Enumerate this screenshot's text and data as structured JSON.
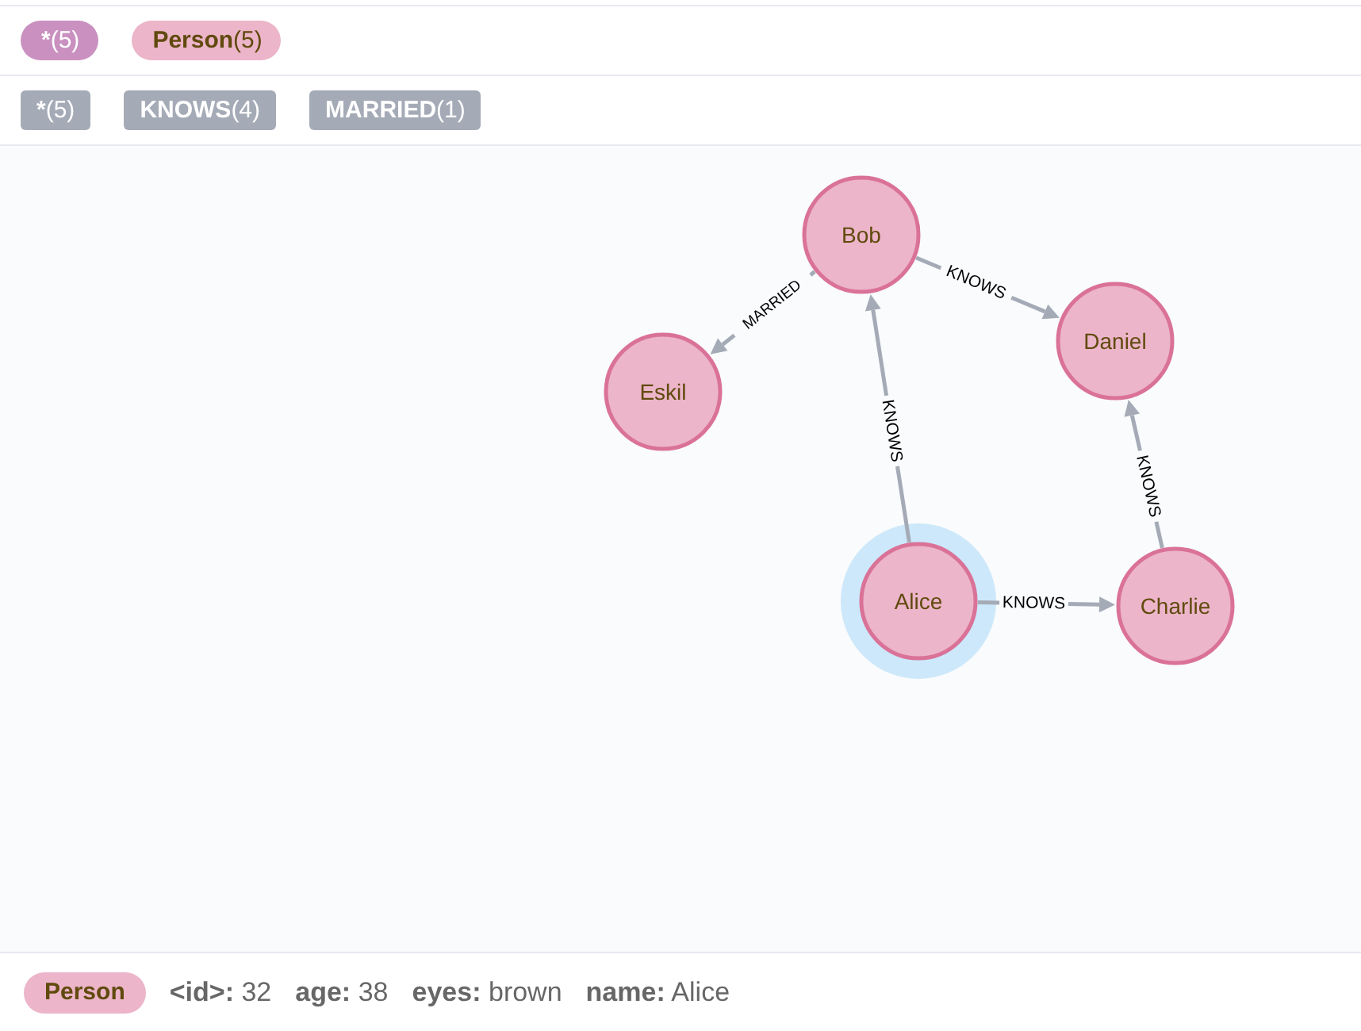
{
  "node_labels": [
    {
      "name": "*",
      "count": "(5)",
      "kind": "all",
      "color": "#c990c0"
    },
    {
      "name": "Person",
      "count": "(5)",
      "kind": "label",
      "color": "#ecb5c9"
    }
  ],
  "relationship_types": [
    {
      "name": "*",
      "count": "(5)"
    },
    {
      "name": "KNOWS",
      "count": "(4)"
    },
    {
      "name": "MARRIED",
      "count": "(1)"
    }
  ],
  "graph": {
    "nodes": [
      {
        "caption": "Bob",
        "selected": false
      },
      {
        "caption": "Daniel",
        "selected": false
      },
      {
        "caption": "Eskil",
        "selected": false
      },
      {
        "caption": "Alice",
        "selected": true
      },
      {
        "caption": "Charlie",
        "selected": false
      }
    ],
    "relationships": [
      {
        "type": "KNOWS"
      },
      {
        "type": "MARRIED"
      },
      {
        "type": "KNOWS"
      },
      {
        "type": "KNOWS"
      },
      {
        "type": "KNOWS"
      }
    ]
  },
  "inspector": {
    "label": "Person",
    "properties": [
      {
        "key": "<id>:",
        "value": "32"
      },
      {
        "key": "age:",
        "value": "38"
      },
      {
        "key": "eyes:",
        "value": "brown"
      },
      {
        "key": "name:",
        "value": "Alice"
      }
    ]
  }
}
